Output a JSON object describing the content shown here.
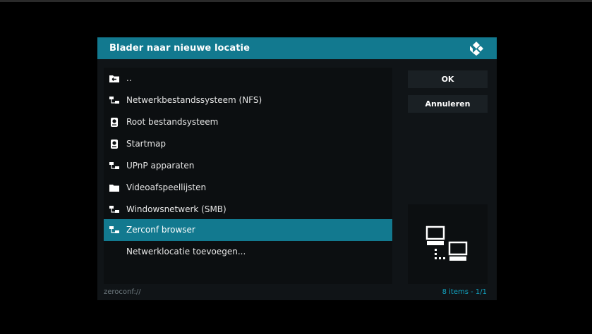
{
  "dialog": {
    "title": "Blader naar nieuwe locatie",
    "logo_icon": "kodi-logo-icon"
  },
  "list": {
    "items": [
      {
        "label": "..",
        "icon": "folder-up-icon"
      },
      {
        "label": "Netwerkbestandssysteem (NFS)",
        "icon": "network-icon"
      },
      {
        "label": "Root bestandsysteem",
        "icon": "hard-disk-icon"
      },
      {
        "label": "Startmap",
        "icon": "hard-disk-icon"
      },
      {
        "label": "UPnP apparaten",
        "icon": "network-icon"
      },
      {
        "label": "Videoafspeellijsten",
        "icon": "folder-icon"
      },
      {
        "label": "Windowsnetwerk (SMB)",
        "icon": "network-icon"
      },
      {
        "label": "Zerconf browser",
        "icon": "network-icon",
        "selected": true
      },
      {
        "label": "Netwerklocatie toevoegen...",
        "icon": ""
      }
    ]
  },
  "buttons": {
    "ok_label": "OK",
    "cancel_label": "Annuleren"
  },
  "preview": {
    "icon": "network-computers-icon"
  },
  "footer": {
    "path": "zeroconf://",
    "count": "8 items - 1/1"
  },
  "colors": {
    "accent": "#12798f",
    "background": "#101417",
    "count_text": "#12a3c0"
  }
}
